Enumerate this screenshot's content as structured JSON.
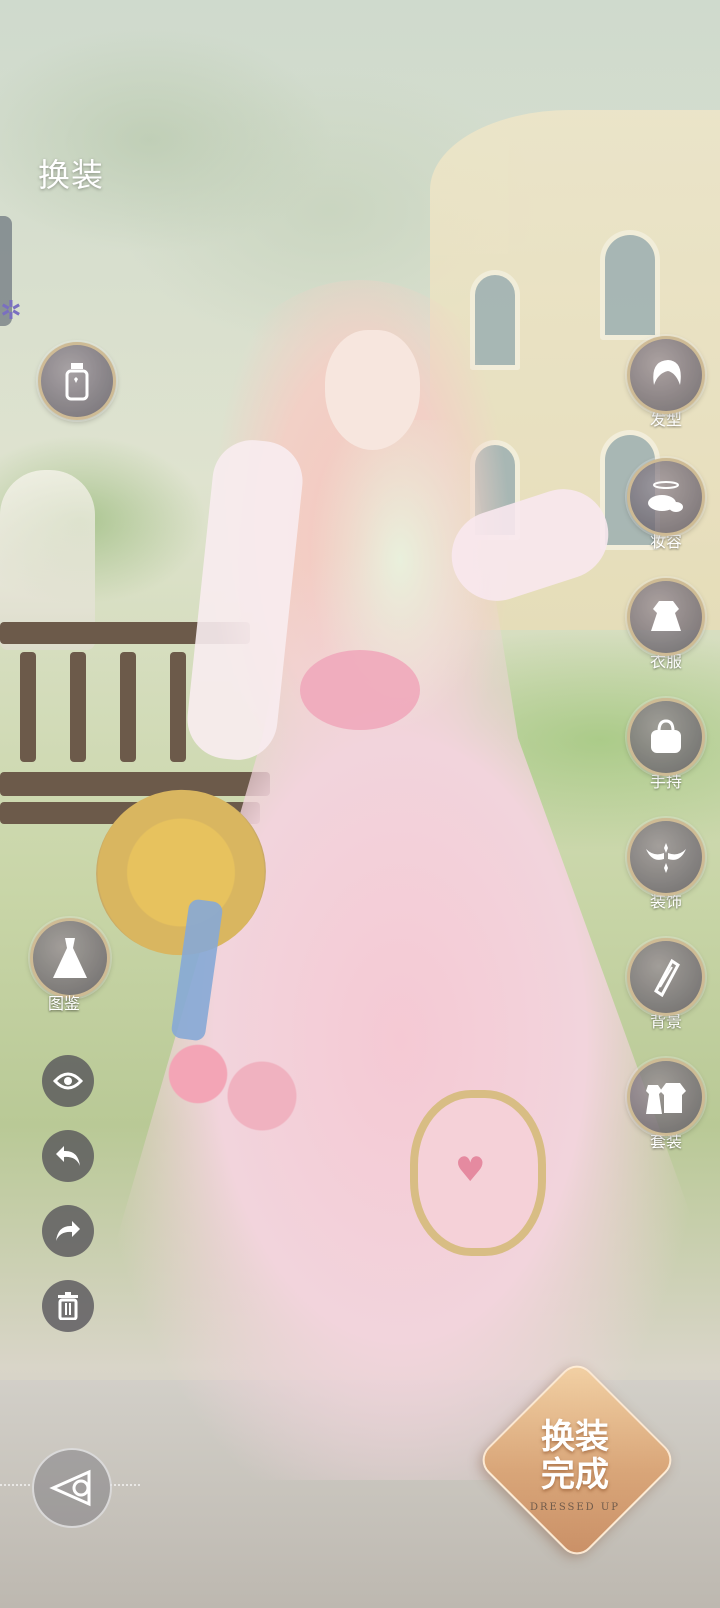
{
  "header": {
    "title": "换装"
  },
  "right_menu": [
    {
      "label": "发型",
      "icon": "hair-icon"
    },
    {
      "label": "妆容",
      "icon": "makeup-icon"
    },
    {
      "label": "衣服",
      "icon": "dress-icon"
    },
    {
      "label": "手持",
      "icon": "handbag-icon"
    },
    {
      "label": "装饰",
      "icon": "wings-icon"
    },
    {
      "label": "背景",
      "icon": "background-icon"
    },
    {
      "label": "套装",
      "icon": "outfit-set-icon"
    }
  ],
  "left_tools": {
    "cosmetic_icon": "bottle-icon",
    "catalog_label": "图鉴",
    "catalog_icon": "gown-icon",
    "view_icon": "eye-icon",
    "undo_icon": "undo-icon",
    "redo_icon": "redo-icon",
    "delete_icon": "trash-icon"
  },
  "done_button": {
    "line1": "换装",
    "line2": "完成",
    "subtitle": "DRESSED UP"
  },
  "camera_icon": "camera-icon"
}
